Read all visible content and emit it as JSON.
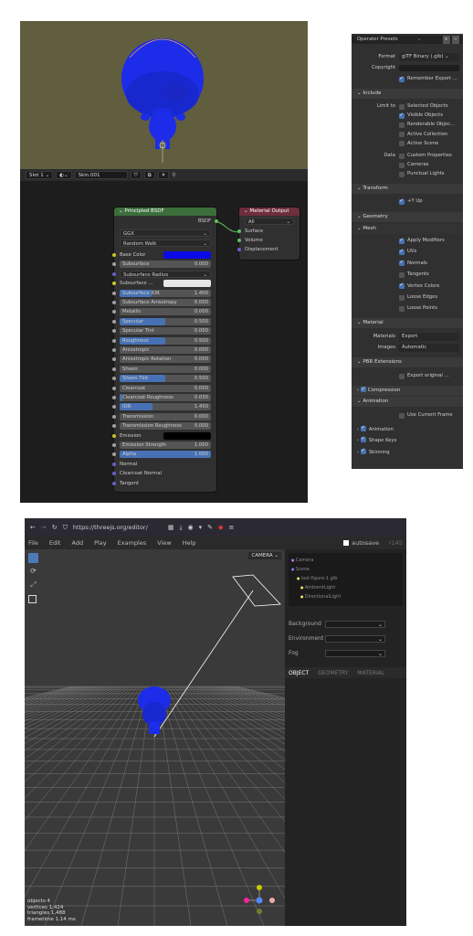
{
  "blender": {
    "slot_label": "Slot 1",
    "material_name": "Skin.001",
    "principled_node": {
      "title": "Principled BSDF",
      "output_label": "BSDF",
      "distribution": "GGX",
      "subsurface_method": "Random Walk",
      "inputs": [
        {
          "label": "Base Color",
          "kind": "color",
          "color": "#0a0ae6"
        },
        {
          "label": "Subsurface",
          "kind": "value",
          "value": "0.000",
          "fill": 0
        },
        {
          "label": "Subsurface Radius",
          "kind": "dropdown"
        },
        {
          "label": "Subsurface …",
          "kind": "color",
          "color": "#e6e6e6"
        },
        {
          "label": "Subsurface IOR",
          "kind": "value",
          "value": "1.400",
          "fill": 0.35
        },
        {
          "label": "Subsurface Anisotropy",
          "kind": "value",
          "value": "0.000",
          "fill": 0
        },
        {
          "label": "Metallic",
          "kind": "value",
          "value": "0.000",
          "fill": 0
        },
        {
          "label": "Specular",
          "kind": "value",
          "value": "0.500",
          "fill": 0.5
        },
        {
          "label": "Specular Tint",
          "kind": "value",
          "value": "0.000",
          "fill": 0
        },
        {
          "label": "Roughness",
          "kind": "value",
          "value": "0.500",
          "fill": 0.5
        },
        {
          "label": "Anisotropic",
          "kind": "value",
          "value": "0.000",
          "fill": 0
        },
        {
          "label": "Anisotropic Rotation",
          "kind": "value",
          "value": "0.000",
          "fill": 0
        },
        {
          "label": "Sheen",
          "kind": "value",
          "value": "0.000",
          "fill": 0
        },
        {
          "label": "Sheen Tint",
          "kind": "value",
          "value": "0.500",
          "fill": 0.5
        },
        {
          "label": "Clearcoat",
          "kind": "value",
          "value": "0.000",
          "fill": 0
        },
        {
          "label": "Clearcoat Roughness",
          "kind": "value",
          "value": "0.030",
          "fill": 0.03
        },
        {
          "label": "IOR",
          "kind": "value",
          "value": "1.450",
          "fill": 0.36
        },
        {
          "label": "Transmission",
          "kind": "value",
          "value": "0.000",
          "fill": 0
        },
        {
          "label": "Transmission Roughness",
          "kind": "value",
          "value": "0.000",
          "fill": 0
        },
        {
          "label": "Emission",
          "kind": "color",
          "color": "#000000"
        },
        {
          "label": "Emission Strength",
          "kind": "value",
          "value": "1.000",
          "fill": 0
        },
        {
          "label": "Alpha",
          "kind": "value",
          "value": "1.000",
          "fill": 1
        },
        {
          "label": "Normal",
          "kind": "socket"
        },
        {
          "label": "Clearcoat Normal",
          "kind": "socket"
        },
        {
          "label": "Tangent",
          "kind": "socket"
        }
      ]
    },
    "output_node": {
      "title": "Material Output",
      "target": "All",
      "inputs": [
        "Surface",
        "Volume",
        "Displacement"
      ]
    }
  },
  "export": {
    "operator_presets": "Operator Presets",
    "format_label": "Format",
    "format_value": "glTF Binary (.glb)",
    "copyright_label": "Copyright",
    "remember_label": "Remember Export …",
    "include": "Include",
    "limit_to": "Limit to",
    "limit_items": [
      {
        "label": "Selected Objects",
        "on": false
      },
      {
        "label": "Visible Objects",
        "on": true
      },
      {
        "label": "Renderable Objec…",
        "on": false
      },
      {
        "label": "Active Collection",
        "on": false
      },
      {
        "label": "Active Scene",
        "on": false
      }
    ],
    "data_label": "Data",
    "data_items": [
      {
        "label": "Custom Properties",
        "on": false
      },
      {
        "label": "Cameras",
        "on": false
      },
      {
        "label": "Punctual Lights",
        "on": false
      }
    ],
    "transform": "Transform",
    "y_up": "+Y Up",
    "geometry": "Geometry",
    "mesh": "Mesh",
    "mesh_items": [
      {
        "label": "Apply Modifiers",
        "on": true
      },
      {
        "label": "UVs",
        "on": true
      },
      {
        "label": "Normals",
        "on": true
      },
      {
        "label": "Tangents",
        "on": false
      },
      {
        "label": "Vertex Colors",
        "on": true
      },
      {
        "label": "Loose Edges",
        "on": false
      },
      {
        "label": "Loose Points",
        "on": false
      }
    ],
    "material": "Material",
    "materials_label": "Materials",
    "materials_value": "Export",
    "images_label": "Images",
    "images_value": "Automatic",
    "pbr": "PBR Extensions",
    "export_original": "Export original …",
    "compression": "Compression",
    "animation": "Animation",
    "use_current_frame": "Use Current Frame",
    "anim_items": [
      "Animation",
      "Shape Keys",
      "Skinning"
    ]
  },
  "threejs": {
    "url": "https://threejs.org/editor/",
    "menu": [
      "File",
      "Edit",
      "Add",
      "Play",
      "Examples",
      "View",
      "Help"
    ],
    "autosave": "autosave",
    "version": "r145",
    "camera": "CAMERA",
    "outliner": [
      "Camera",
      "Scene",
      "last-figure-1.glb",
      "AmbientLight",
      "DirectionalLight"
    ],
    "background_label": "Background",
    "environment_label": "Environment",
    "fog_label": "Fog",
    "tabs": [
      "OBJECT",
      "GEOMETRY",
      "MATERIAL"
    ],
    "stats": {
      "objects": "objects  4",
      "vertices": "vertices  1,424",
      "triangles": "triangles  1,488",
      "frametime": "frametime  1.14 ms"
    }
  }
}
